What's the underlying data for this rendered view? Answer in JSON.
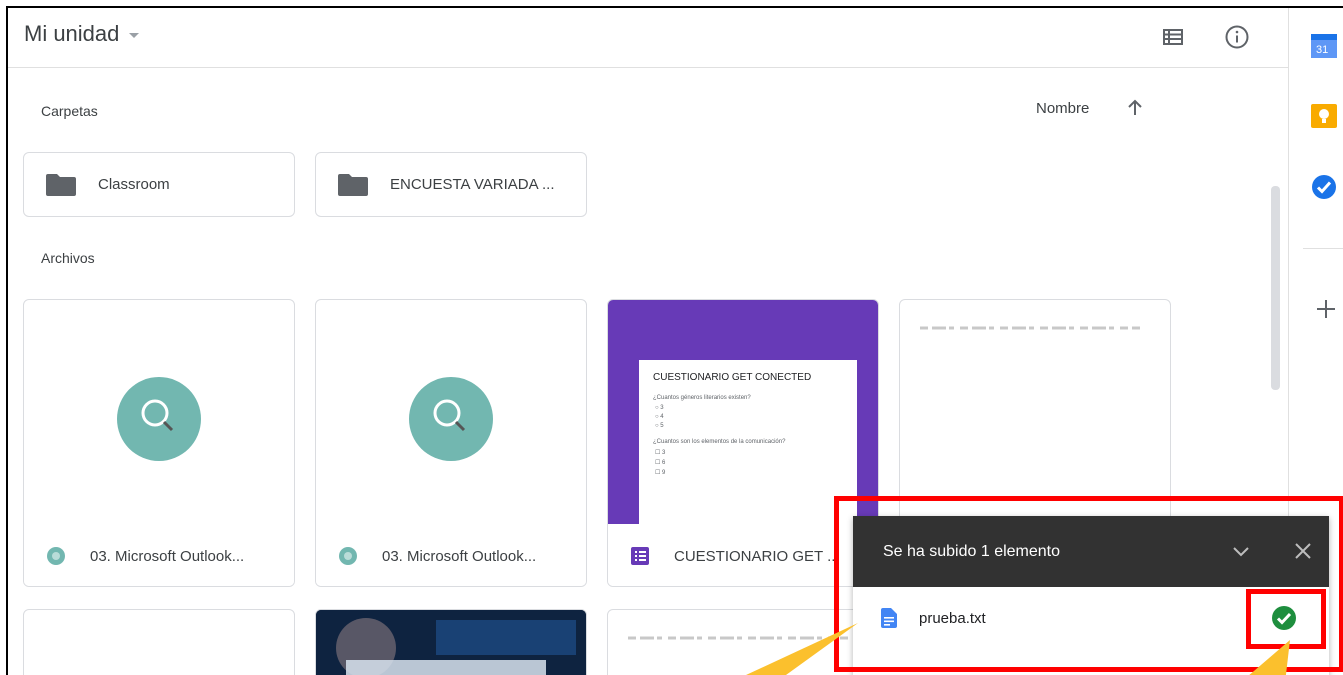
{
  "header": {
    "title": "Mi unidad",
    "list_view_icon": "list-view-icon",
    "info_icon": "info-icon"
  },
  "sections": {
    "folders_label": "Carpetas",
    "files_label": "Archivos",
    "sort_label": "Nombre",
    "sort_icon": "arrow-up-icon"
  },
  "folders": [
    {
      "name": "Classroom"
    },
    {
      "name": "ENCUESTA VARIADA ..."
    }
  ],
  "files": [
    {
      "name": "03. Microsoft Outlook...",
      "icon": "video-file-icon"
    },
    {
      "name": "03. Microsoft Outlook...",
      "icon": "video-file-icon"
    },
    {
      "name": "CUESTIONARIO GET ...",
      "icon": "forms-icon"
    },
    {
      "name": "",
      "icon": ""
    }
  ],
  "form_preview": {
    "title": "CUESTIONARIO GET CONECTED",
    "q1": "¿Cuantos géneros literarios existen?",
    "q1_opts": [
      "3",
      "4",
      "5"
    ],
    "q2": "¿Cuantos son los elementos de la comunicación?",
    "q2_opts": [
      "3",
      "6",
      "9"
    ]
  },
  "upload_toast": {
    "title": "Se ha subido 1 elemento",
    "file_name": "prueba.txt",
    "status": "complete"
  },
  "colors": {
    "accent_green": "#1e8e3e",
    "forms_purple": "#673ab7",
    "teal": "#72b7b0",
    "annotation_red": "#ff0000",
    "annotation_yellow": "#fbc02d"
  }
}
